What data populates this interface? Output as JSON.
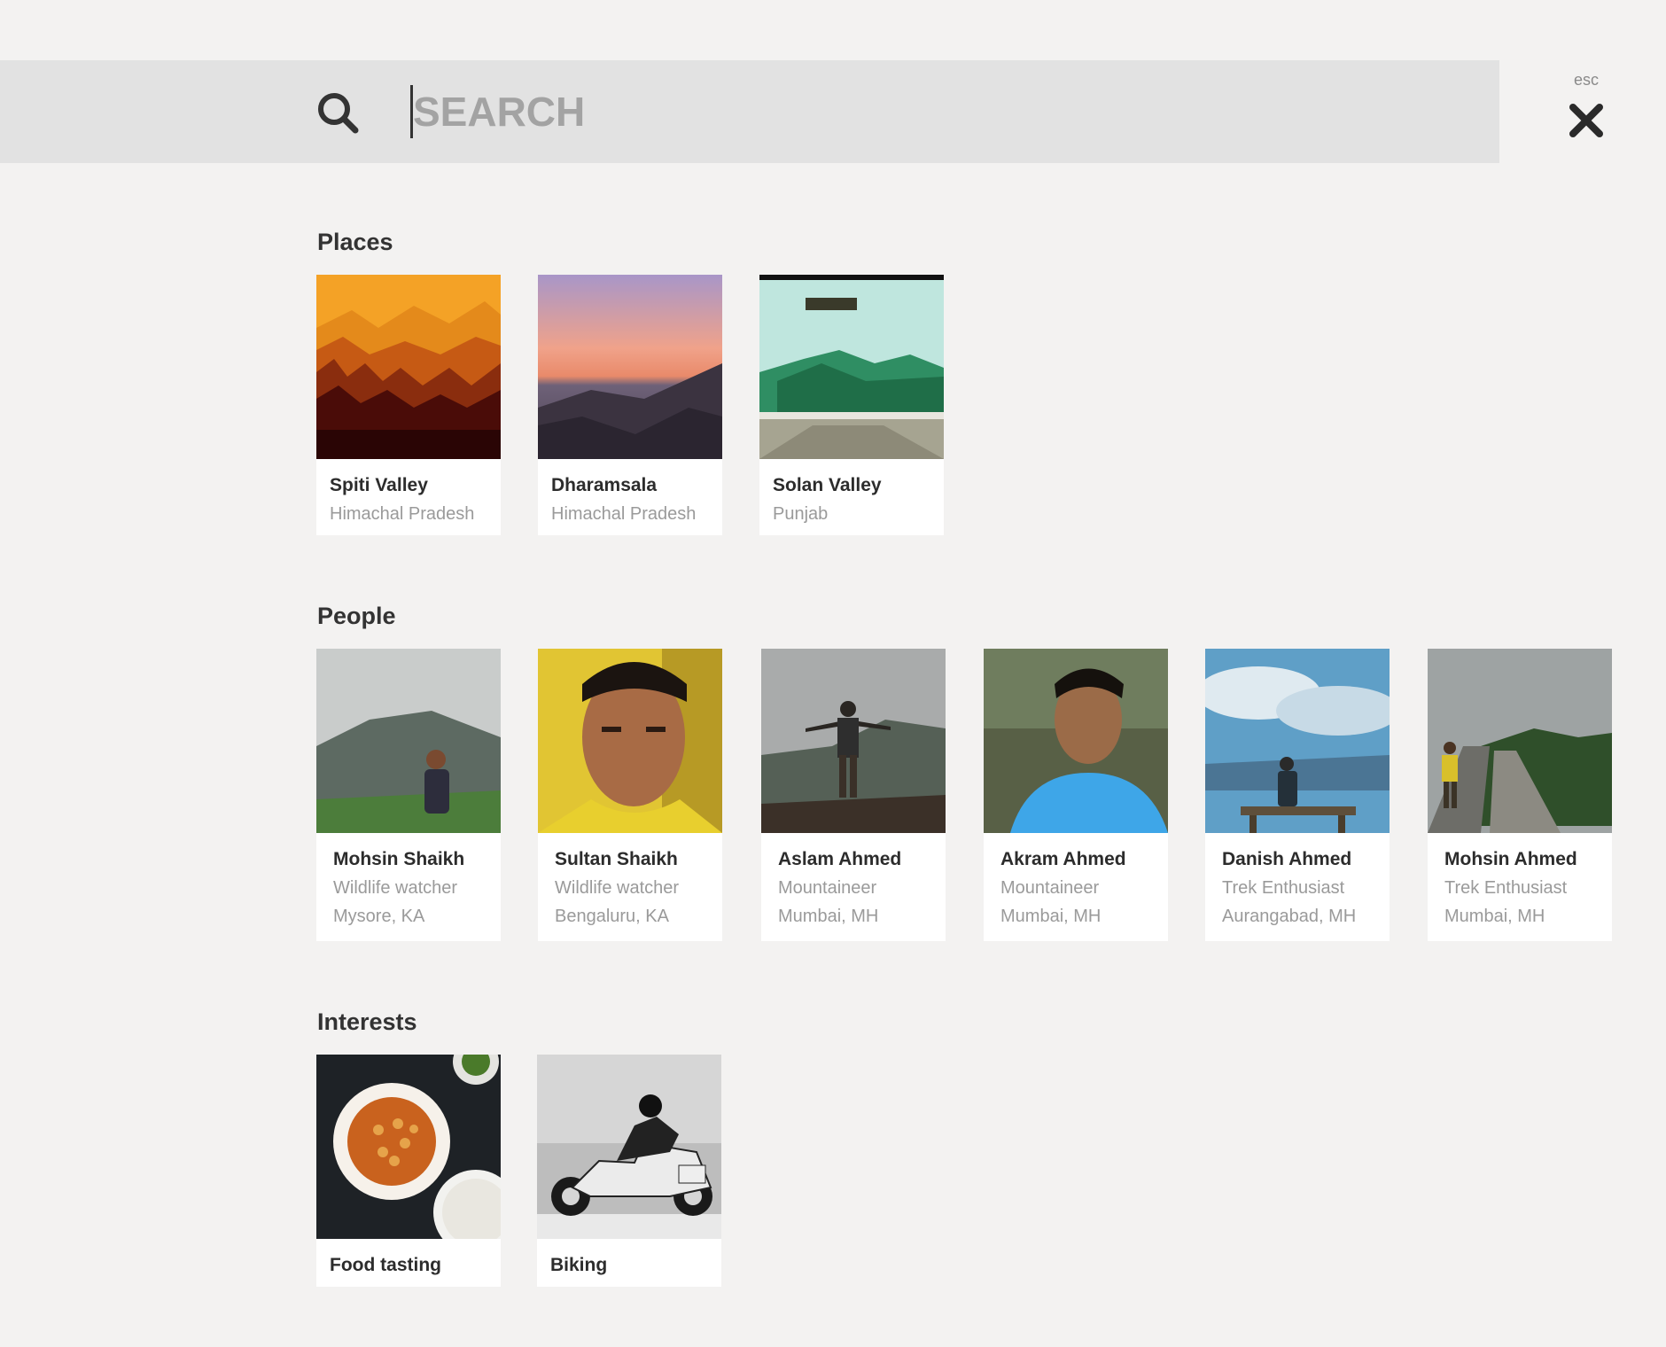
{
  "search": {
    "placeholder": "SEARCH",
    "value": "",
    "close_hint": "esc"
  },
  "sections": {
    "places": {
      "title": "Places",
      "items": [
        {
          "name": "Spiti Valley",
          "region": "Himachal Pradesh"
        },
        {
          "name": "Dharamsala",
          "region": "Himachal Pradesh"
        },
        {
          "name": "Solan Valley",
          "region": "Punjab"
        }
      ]
    },
    "people": {
      "title": "People",
      "items": [
        {
          "name": "Mohsin Shaikh",
          "role": "Wildlife watcher",
          "location": "Mysore, KA"
        },
        {
          "name": "Sultan Shaikh",
          "role": "Wildlife watcher",
          "location": "Bengaluru, KA"
        },
        {
          "name": "Aslam Ahmed",
          "role": "Mountaineer",
          "location": "Mumbai, MH"
        },
        {
          "name": "Akram Ahmed",
          "role": "Mountaineer",
          "location": "Mumbai, MH"
        },
        {
          "name": "Danish Ahmed",
          "role": "Trek Enthusiast",
          "location": "Aurangabad, MH"
        },
        {
          "name": "Mohsin Ahmed",
          "role": "Trek Enthusiast",
          "location": "Mumbai, MH"
        }
      ]
    },
    "interests": {
      "title": "Interests",
      "items": [
        {
          "name": "Food tasting"
        },
        {
          "name": "Biking"
        }
      ]
    }
  },
  "icons": {
    "search": "search-icon",
    "close": "close-icon"
  },
  "colors": {
    "background": "#f3f2f1",
    "search_bar": "#e2e2e2",
    "placeholder": "#a3a3a3",
    "title_text": "#333333",
    "subtitle_text": "#9a9a9a"
  }
}
